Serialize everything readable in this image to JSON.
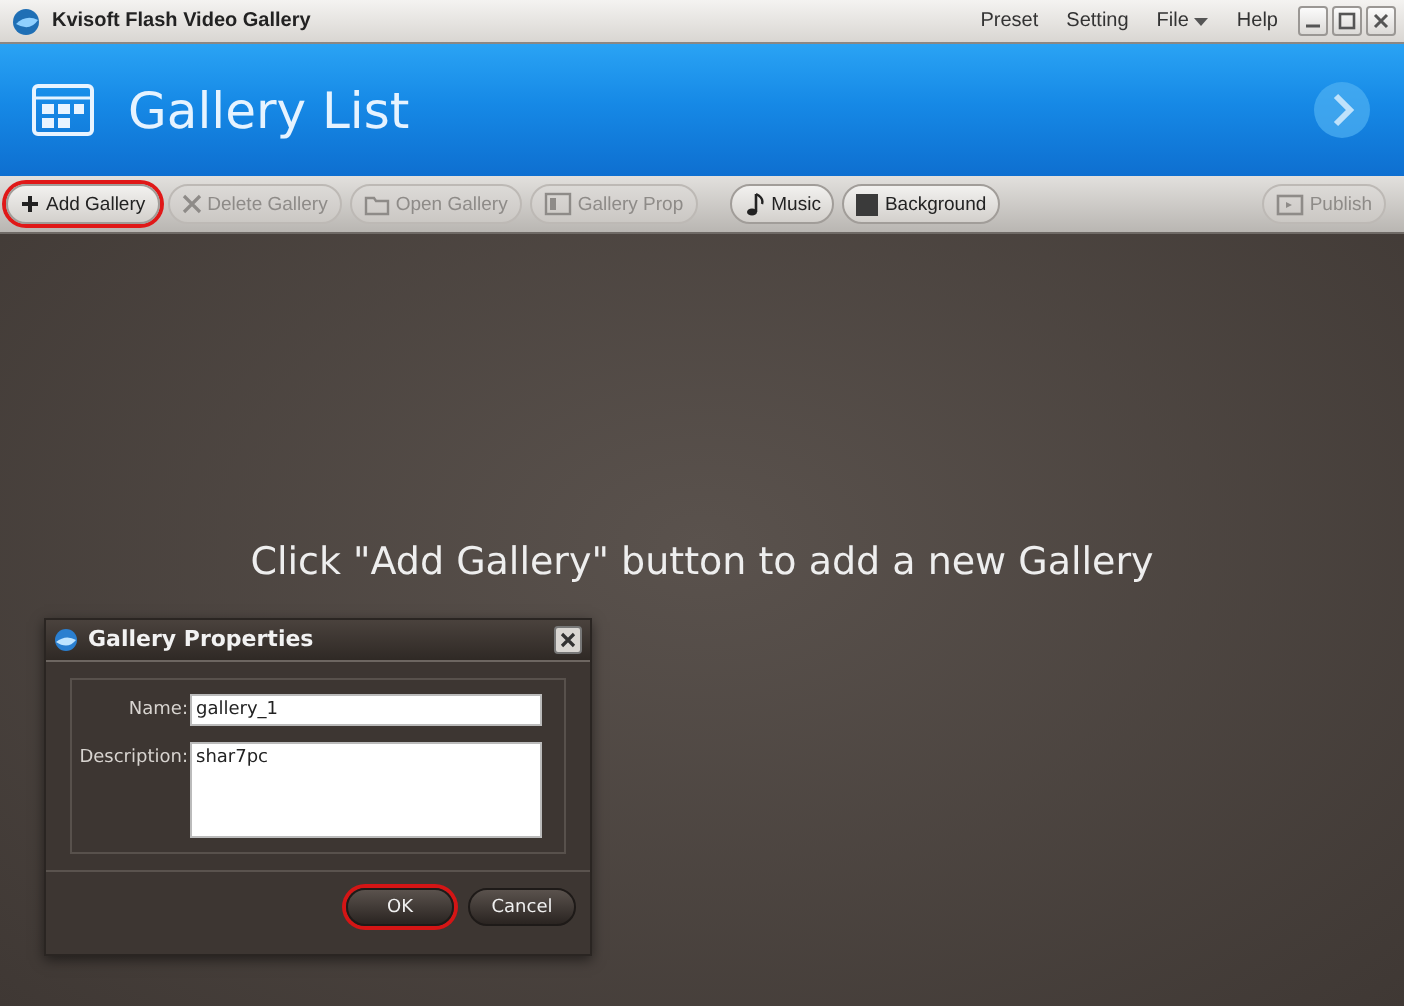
{
  "window": {
    "title": "Kvisoft Flash Video Gallery",
    "menu": [
      {
        "label": "Preset",
        "kind": "plain"
      },
      {
        "label": "Setting",
        "kind": "plain"
      },
      {
        "label": "File",
        "kind": "dropdown"
      },
      {
        "label": "Help",
        "kind": "plain"
      }
    ]
  },
  "header": {
    "title": "Gallery List"
  },
  "toolbar": {
    "gallery_buttons": [
      {
        "label": "Add Gallery",
        "kind": "plus",
        "disabled": false,
        "highlighted": true
      },
      {
        "label": "Delete Gallery",
        "kind": "cross",
        "disabled": true,
        "highlighted": false
      },
      {
        "label": "Open Gallery",
        "kind": "folder",
        "disabled": true,
        "highlighted": false
      },
      {
        "label": "Gallery Prop",
        "kind": "props",
        "disabled": true,
        "highlighted": false
      }
    ],
    "media_buttons": [
      {
        "label": "Music",
        "kind": "note",
        "disabled": false,
        "highlighted": false
      },
      {
        "label": "Background",
        "kind": "square",
        "disabled": false,
        "highlighted": false
      }
    ],
    "publish_button": {
      "label": "Publish",
      "kind": "publish",
      "disabled": true,
      "highlighted": false
    }
  },
  "hint": "Click \"Add Gallery\" button to add a new Gallery",
  "dialog": {
    "title": "Gallery Properties",
    "fields": [
      {
        "label": "Name:",
        "value": "gallery_1",
        "kind": "line"
      },
      {
        "label": "Description:",
        "value": "shar7pc",
        "kind": "area"
      }
    ],
    "buttons": [
      {
        "label": "OK",
        "highlighted": true
      },
      {
        "label": "Cancel",
        "highlighted": false
      }
    ]
  }
}
